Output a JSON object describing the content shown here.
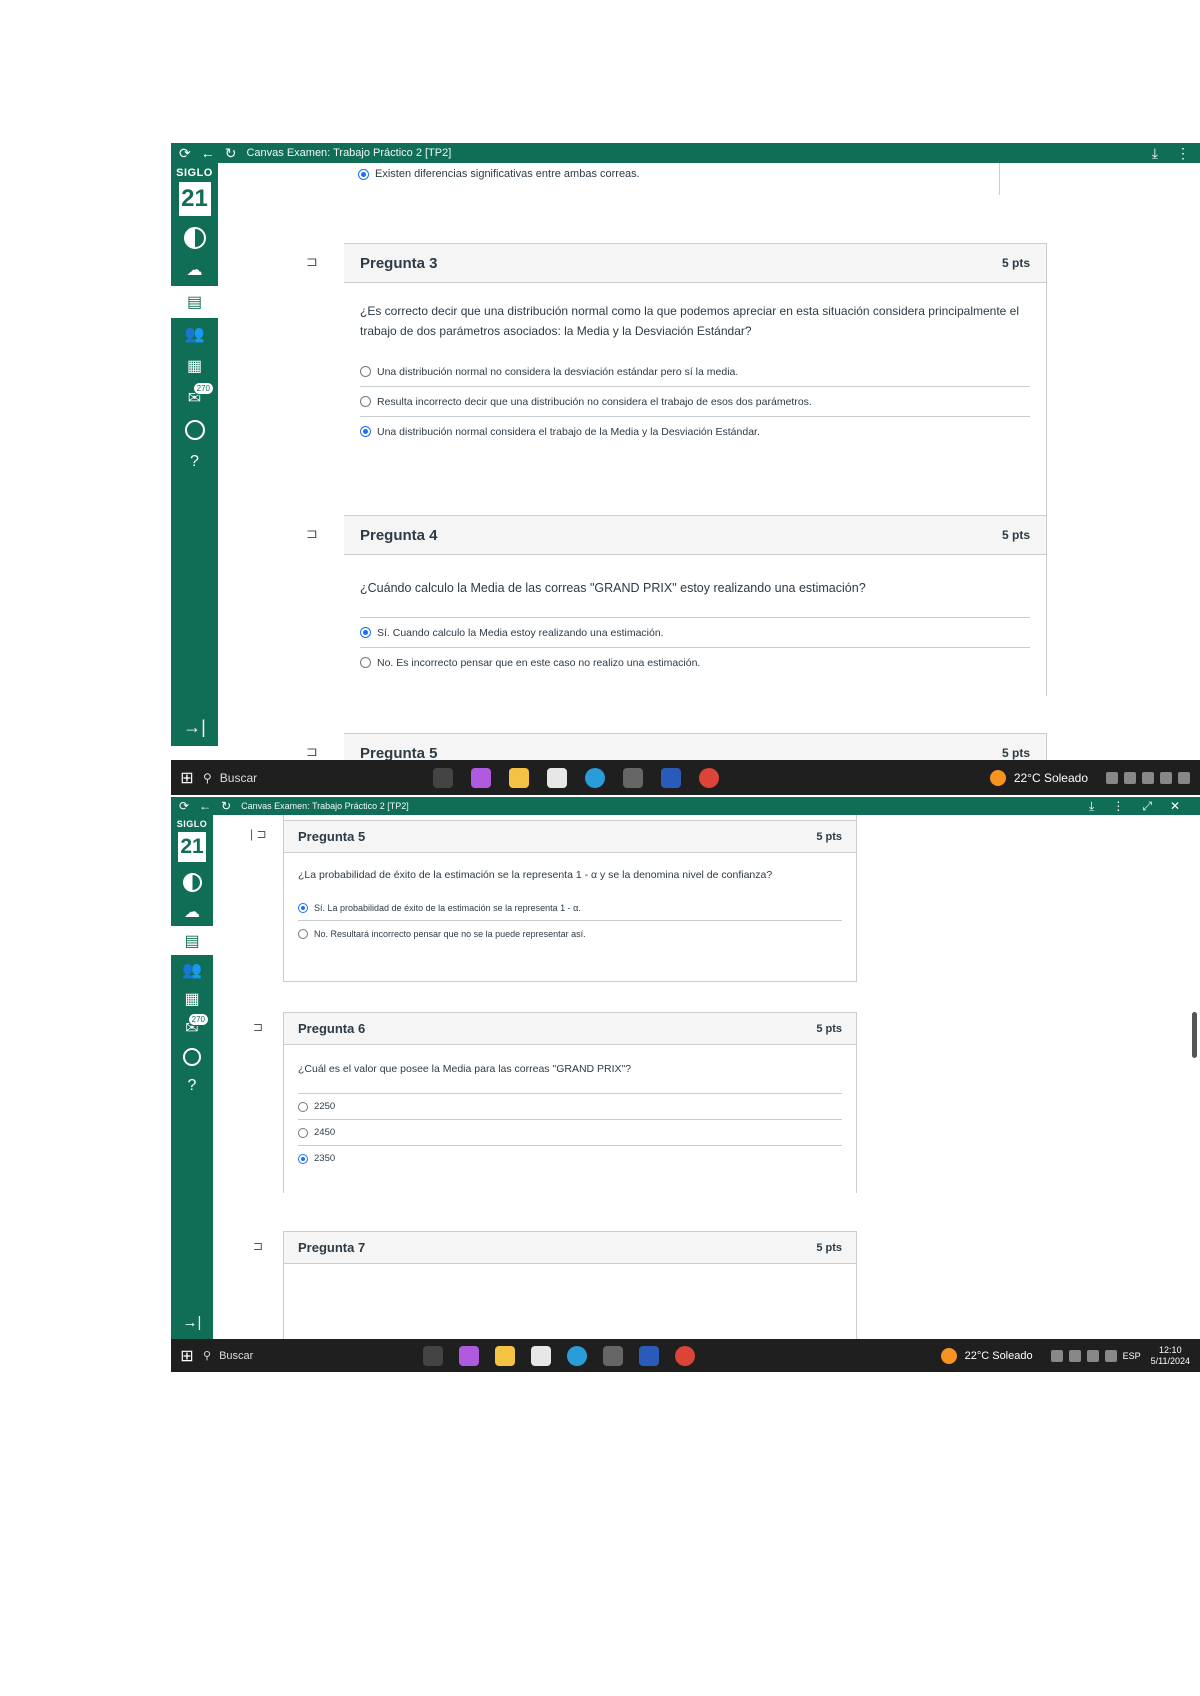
{
  "window": {
    "title": "Canvas  Examen: Trabajo Práctico 2 [TP2]"
  },
  "sidebar": {
    "logo_word": "SIGLO",
    "logo_number": "21",
    "badge": "270"
  },
  "taskbar": {
    "search_label": "Buscar",
    "weather": "22°C  Soleado",
    "clock_time": "12:10",
    "clock_date": "5/11/2024",
    "lang": "ESP"
  },
  "shot1": {
    "prev_answer": "Existen diferencias significativas entre ambas correas.",
    "questions": [
      {
        "title": "Pregunta 3",
        "points": "5 pts",
        "text": "¿Es correcto decir que una distribución normal como la que podemos apreciar en esta situación considera principalmente el trabajo de dos parámetros asociados: la Media y la Desviación Estándar?",
        "answers": [
          {
            "label": "Una distribución normal no considera la desviación estándar pero sí la media.",
            "selected": false
          },
          {
            "label": "Resulta incorrecto decir que una distribución no considera el trabajo de esos dos parámetros.",
            "selected": false
          },
          {
            "label": "Una distribución normal considera el trabajo de la Media y la Desviación Estándar.",
            "selected": true
          }
        ]
      },
      {
        "title": "Pregunta 4",
        "points": "5 pts",
        "text": "¿Cuándo calculo la Media de las correas \"GRAND PRIX\" estoy realizando una estimación?",
        "answers": [
          {
            "label": "Sí. Cuando calculo la Media estoy realizando una estimación.",
            "selected": true
          },
          {
            "label": "No. Es incorrecto pensar que en este caso no realizo una estimación.",
            "selected": false
          }
        ]
      },
      {
        "title": "Pregunta 5",
        "points": "5 pts"
      }
    ]
  },
  "shot2": {
    "questions": [
      {
        "title": "Pregunta 5",
        "points": "5 pts",
        "text": "¿La probabilidad de éxito de la estimación se la representa 1 - α y se la denomina nivel de confianza?",
        "answers": [
          {
            "label": "Sí. La probabilidad de éxito de la estimación se la representa 1 - α.",
            "selected": true
          },
          {
            "label": "No. Resultará incorrecto pensar que no se la puede representar así.",
            "selected": false
          }
        ]
      },
      {
        "title": "Pregunta 6",
        "points": "5 pts",
        "text": "¿Cuál es el valor que posee la Media para las correas \"GRAND PRIX\"?",
        "answers": [
          {
            "label": "2250",
            "selected": false
          },
          {
            "label": "2450",
            "selected": false
          },
          {
            "label": "2350",
            "selected": true
          }
        ]
      },
      {
        "title": "Pregunta 7",
        "points": "5 pts"
      }
    ]
  },
  "colors": {
    "brand_green": "#0f6e55",
    "radio_selected": "#1b6ff5",
    "taskbar": "#1f1f1f"
  }
}
